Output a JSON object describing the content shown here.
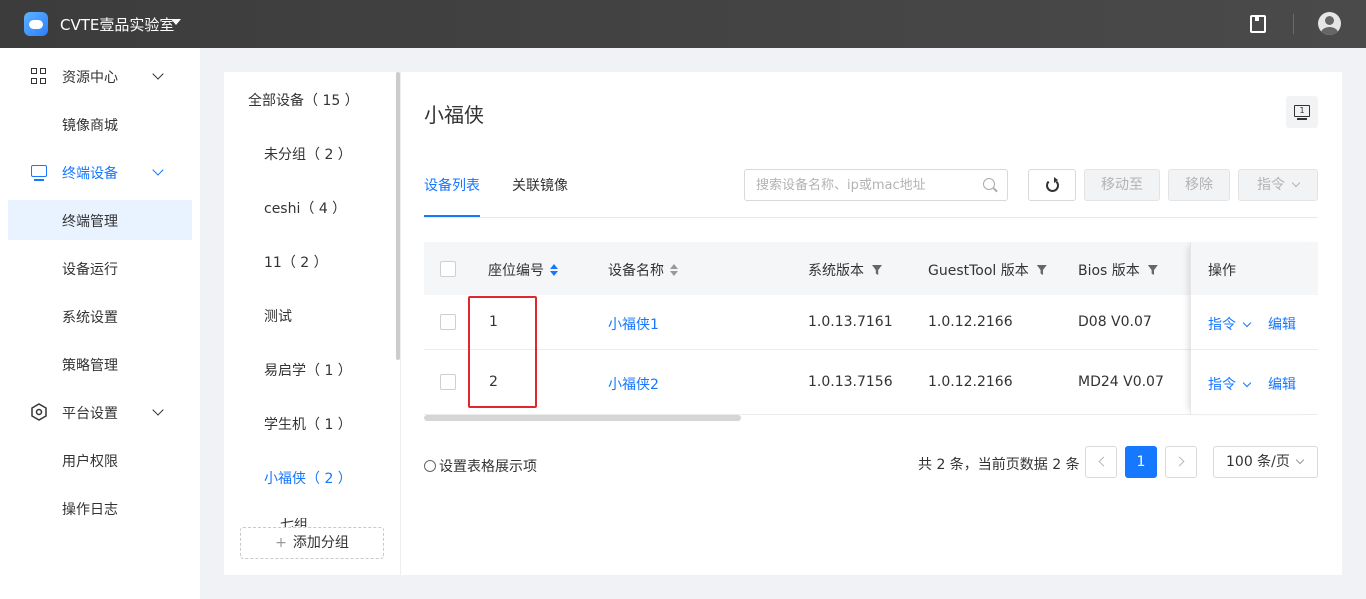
{
  "topbar": {
    "lab_name": "CVTE壹品实验室"
  },
  "sidebar": {
    "items": [
      {
        "label": "资源中心"
      },
      {
        "label": "镜像商城"
      },
      {
        "label": "终端设备"
      },
      {
        "label": "终端管理"
      },
      {
        "label": "设备运行"
      },
      {
        "label": "系统设置"
      },
      {
        "label": "策略管理"
      },
      {
        "label": "平台设置"
      },
      {
        "label": "用户权限"
      },
      {
        "label": "操作日志"
      }
    ]
  },
  "groups": {
    "items": [
      {
        "label": "全部设备（ 15 ）"
      },
      {
        "label": "未分组（ 2 ）"
      },
      {
        "label": "ceshi（ 4 ）"
      },
      {
        "label": "11（ 2 ）"
      },
      {
        "label": "测试"
      },
      {
        "label": "易启学（ 1 ）"
      },
      {
        "label": "学生机（ 1 ）"
      },
      {
        "label": "小福侠（ 2 ）"
      },
      {
        "label": "七组"
      }
    ],
    "add_label": "添加分组",
    "selected": "小福侠（ 2 ）"
  },
  "main": {
    "title": "小福侠",
    "tabs": [
      {
        "label": "设备列表"
      },
      {
        "label": "关联镜像"
      }
    ],
    "search_placeholder": "搜索设备名称、ip或mac地址",
    "buttons": {
      "move": "移动至",
      "remove": "移除",
      "command": "指令"
    }
  },
  "table": {
    "headers": [
      "座位编号",
      "设备名称",
      "系统版本",
      "GuestTool 版本",
      "Bios 版本",
      "操作"
    ],
    "rows": [
      {
        "seat": "1",
        "name": "小福侠1",
        "os": "1.0.13.7161",
        "guesttool": "1.0.12.2166",
        "bios": "D08 V0.07",
        "op_cmd": "指令",
        "op_edit": "编辑"
      },
      {
        "seat": "2",
        "name": "小福侠2",
        "os": "1.0.13.7156",
        "guesttool": "1.0.12.2166",
        "bios": "MD24 V0.07",
        "op_cmd": "指令",
        "op_edit": "编辑"
      }
    ]
  },
  "footer": {
    "set_columns": "设置表格展示项",
    "total": "共 2 条，当前页数据 2 条",
    "current_page": "1",
    "page_size": "100 条/页"
  },
  "colors": {
    "accent": "#1677ff",
    "highlight": "#e0262f"
  }
}
